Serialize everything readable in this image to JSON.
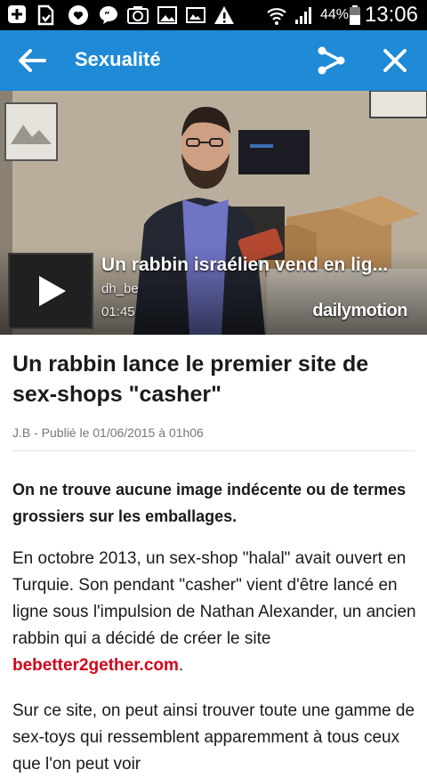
{
  "status_bar": {
    "battery_percent": "44%",
    "time": "13:06",
    "icons": [
      "add-box-icon",
      "sd-card-icon",
      "heart-icon",
      "message-icon",
      "camera-icon",
      "image-icon",
      "gallery-icon",
      "warning-icon",
      "wifi-icon",
      "signal-icon",
      "battery-icon"
    ]
  },
  "app_bar": {
    "title": "Sexualité",
    "back_icon": "arrow-left-icon",
    "share_icon": "share-icon",
    "close_icon": "close-icon",
    "color": "#1f8ad6"
  },
  "video": {
    "title": "Un rabbin israélien vend en lig...",
    "channel": "dh_be",
    "duration": "01:45",
    "brand": "dailymotion"
  },
  "article": {
    "headline": "Un rabbin lance le premier site de sex-shops \"casher\"",
    "meta": "J.B - Publié le 01/06/2015 à 01h06",
    "lead": "On ne trouve aucune image indécente ou de termes grossiers sur les emballages.",
    "para1_text": "En octobre 2013, un sex-shop \"halal\" avait ouvert en Turquie. Son pendant \"casher\" vient d'être lancé en ligne sous l'impulsion de Nathan Alexander, un ancien rabbin qui a décidé de créer le site ",
    "para1_link": "bebetter2gether.com",
    "para1_end": ".",
    "para2_text": "Sur ce site, on peut ainsi trouver toute une gamme de sex-toys qui ressemblent apparemment à tous ceux que l'on peut voir",
    "link_color": "#d0021b"
  }
}
